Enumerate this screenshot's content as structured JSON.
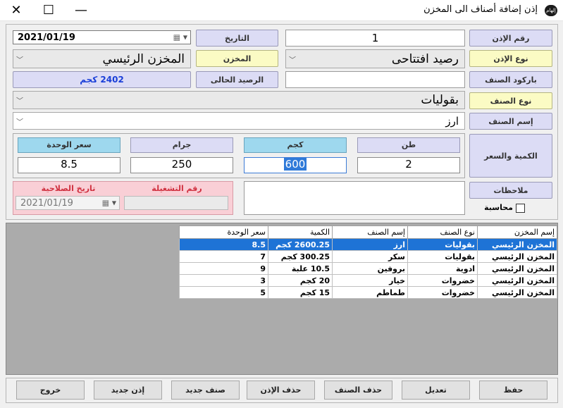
{
  "window": {
    "title": "إذن إضافة أصناف الى المخزن",
    "app_icon_text": "إلهام"
  },
  "form": {
    "permit_number_label": "رقم الإذن",
    "permit_number_value": "1",
    "date_label": "التاريخ",
    "date_value": "2021/01/19",
    "permit_type_label": "نوع الإذن",
    "permit_type_value": "رصيد افتتاحى",
    "warehouse_label": "المخزن",
    "warehouse_value": "المخزن الرئيسي",
    "barcode_label": "باركود الصنف",
    "barcode_value": "",
    "balance_label": "الرصيد الحالى",
    "balance_value": "2402 كجم",
    "item_type_label": "نوع الصنف",
    "item_type_value": "بقوليات",
    "item_name_label": "إسم الصنف",
    "item_name_value": "ارز",
    "qty_price_label": "الكمية والسعر",
    "units": [
      {
        "label": "طن",
        "value": "2"
      },
      {
        "label": "كجم",
        "value": "600"
      },
      {
        "label": "جرام",
        "value": "250"
      },
      {
        "label": "سعر الوحدة",
        "value": "8.5"
      }
    ],
    "notes_label": "ملاحظات",
    "notes_value": "",
    "accounting_label": "محاسبة",
    "batch_label": "رقم التشغيلة",
    "batch_value": "",
    "expiry_label": "تاريخ الصلاحية",
    "expiry_value": "2021/01/19"
  },
  "grid": {
    "columns": [
      "إسم المخزن",
      "نوع الصنف",
      "إسم الصنف",
      "الكمية",
      "سعر الوحدة"
    ],
    "rows": [
      [
        "المخزن الرئيسي",
        "بقوليات",
        "ارز",
        "2600.25 كجم",
        "8.5"
      ],
      [
        "المخزن الرئيسي",
        "بقوليات",
        "سكر",
        "300.25 كجم",
        "7"
      ],
      [
        "المخزن الرئيسي",
        "ادوية",
        "بروفين",
        "10.5 علبة",
        "9"
      ],
      [
        "المخزن الرئيسي",
        "خضروات",
        "خيار",
        "20 كجم",
        "3"
      ],
      [
        "المخزن الرئيسي",
        "خضروات",
        "طماطم",
        "15 كجم",
        "5"
      ]
    ],
    "selected_row": 0
  },
  "buttons": {
    "save": "حفظ",
    "edit": "تعديل",
    "delete_item": "حذف الصنف",
    "delete_permit": "حذف الإذن",
    "new_item": "صنف جديد",
    "new_permit": "إذن جديد",
    "exit": "خروج"
  },
  "icons": {
    "minimize": "minimize-icon",
    "maximize": "maximize-icon",
    "close": "close-icon",
    "calendar": "calendar-icon",
    "dropdown": "chevron-down-icon"
  }
}
